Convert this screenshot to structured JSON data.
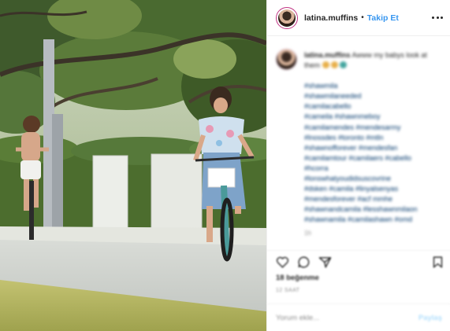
{
  "post": {
    "username": "latina.muffins",
    "separator": "•",
    "follow_label": "Takip Et",
    "more_icon": "more-horizontal-icon"
  },
  "caption": {
    "username": "latina.muffins",
    "text": "Awww my babys look at them",
    "hashtags": [
      "#shawmila",
      "#shawmilaneeded",
      "#camilacabello",
      "#cameila #shawnmeboy",
      "#camilamendes #mendesarmy",
      "#lnossdes #toronto #mtln",
      "#shawnofforever #mendesfan",
      "#camilamtour #camilaers #cabello",
      "#hcorra",
      "#lonswhatyoudidsuscovrine",
      "#dsken #camila #linyalsenyas",
      "#mendesforever #acf mmhe",
      "#shawnandcamila #lesshawnmilaon",
      "#shawnamila #camilashawn #omd"
    ],
    "time": "1h"
  },
  "actions": {
    "like_icon": "heart-icon",
    "comment_icon": "comment-icon",
    "share_icon": "share-icon",
    "save_icon": "bookmark-icon"
  },
  "likes": "18 beğenme",
  "date": "12 SAAT",
  "comment": {
    "placeholder": "Yorum ekle...",
    "post_label": "Paylaş"
  },
  "colors": {
    "link_blue": "#3897f0",
    "hashtag": "#00376b",
    "story_ring": "#c13584",
    "post_disabled": "#b2dffc"
  }
}
